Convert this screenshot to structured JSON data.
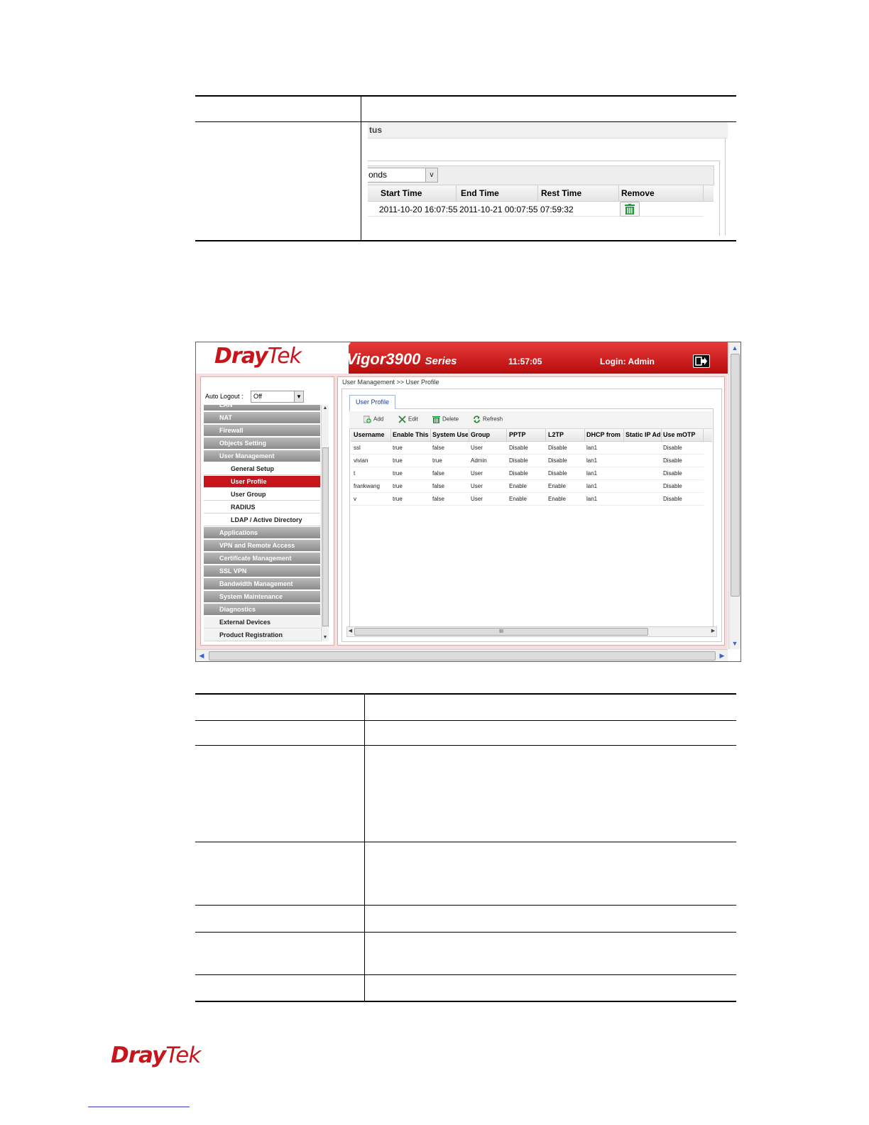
{
  "snippet": {
    "tab_label": "tus",
    "select_value": "onds",
    "select_arrow": "v",
    "headers": [
      "Start Time",
      "End Time",
      "Rest Time",
      "Remove"
    ],
    "row": [
      "2011-10-20 16:07:55",
      "2011-10-21 00:07:55",
      "07:59:32"
    ],
    "remove_icon": "trash-icon"
  },
  "header": {
    "logo_dray": "Dray",
    "logo_tek": "Tek",
    "model": "Vigor3900",
    "series": "Series",
    "time": "11:57:05",
    "login": "Login: Admin",
    "logout_icon": "logout-icon"
  },
  "sidebar": {
    "auto_logout_label": "Auto Logout :",
    "auto_logout_value": "Off",
    "items": [
      {
        "label": "LAN",
        "kind": "cat"
      },
      {
        "label": "NAT",
        "kind": "cat"
      },
      {
        "label": "Firewall",
        "kind": "cat"
      },
      {
        "label": "Objects Setting",
        "kind": "cat"
      },
      {
        "label": "User Management",
        "kind": "cat"
      },
      {
        "label": "General Setup",
        "kind": "sub"
      },
      {
        "label": "User Profile",
        "kind": "sub",
        "active": true
      },
      {
        "label": "User Group",
        "kind": "sub"
      },
      {
        "label": "RADIUS",
        "kind": "sub"
      },
      {
        "label": "LDAP / Active Directory",
        "kind": "sub"
      },
      {
        "label": "Applications",
        "kind": "cat"
      },
      {
        "label": "VPN and Remote Access",
        "kind": "cat"
      },
      {
        "label": "Certificate Management",
        "kind": "cat"
      },
      {
        "label": "SSL VPN",
        "kind": "cat"
      },
      {
        "label": "Bandwidth Management",
        "kind": "cat"
      },
      {
        "label": "System Maintenance",
        "kind": "cat"
      },
      {
        "label": "Diagnostics",
        "kind": "cat"
      },
      {
        "label": "External Devices",
        "kind": "plain"
      },
      {
        "label": "Product Registration",
        "kind": "plain"
      }
    ]
  },
  "main": {
    "breadcrumb": "User Management >> User Profile",
    "tab": "User Profile",
    "toolbar": {
      "add": "Add",
      "edit": "Edit",
      "delete": "Delete",
      "refresh": "Refresh"
    },
    "columns": [
      "Username",
      "Enable This",
      "System Use",
      "Group",
      "PPTP",
      "L2TP",
      "DHCP from",
      "Static IP Ad",
      "Use mOTP"
    ],
    "rows": [
      [
        "ssl",
        "true",
        "false",
        "User",
        "Disable",
        "Disable",
        "lan1",
        "",
        "Disable"
      ],
      [
        "vivian",
        "true",
        "true",
        "Admin",
        "Disable",
        "Disable",
        "lan1",
        "",
        "Disable"
      ],
      [
        "t",
        "true",
        "false",
        "User",
        "Disable",
        "Disable",
        "lan1",
        "",
        "Disable"
      ],
      [
        "frankwang",
        "true",
        "false",
        "User",
        "Enable",
        "Enable",
        "lan1",
        "",
        "Disable"
      ],
      [
        "v",
        "true",
        "false",
        "User",
        "Enable",
        "Enable",
        "lan1",
        "",
        "Disable"
      ]
    ],
    "scroll_grip": "III"
  },
  "footer": {
    "logo_dray": "Dray",
    "logo_tek": "Tek"
  },
  "colors": {
    "brand_red": "#c8151b",
    "frame_blue": "#3a63c8",
    "menu_gray": "#8c8c8c"
  }
}
